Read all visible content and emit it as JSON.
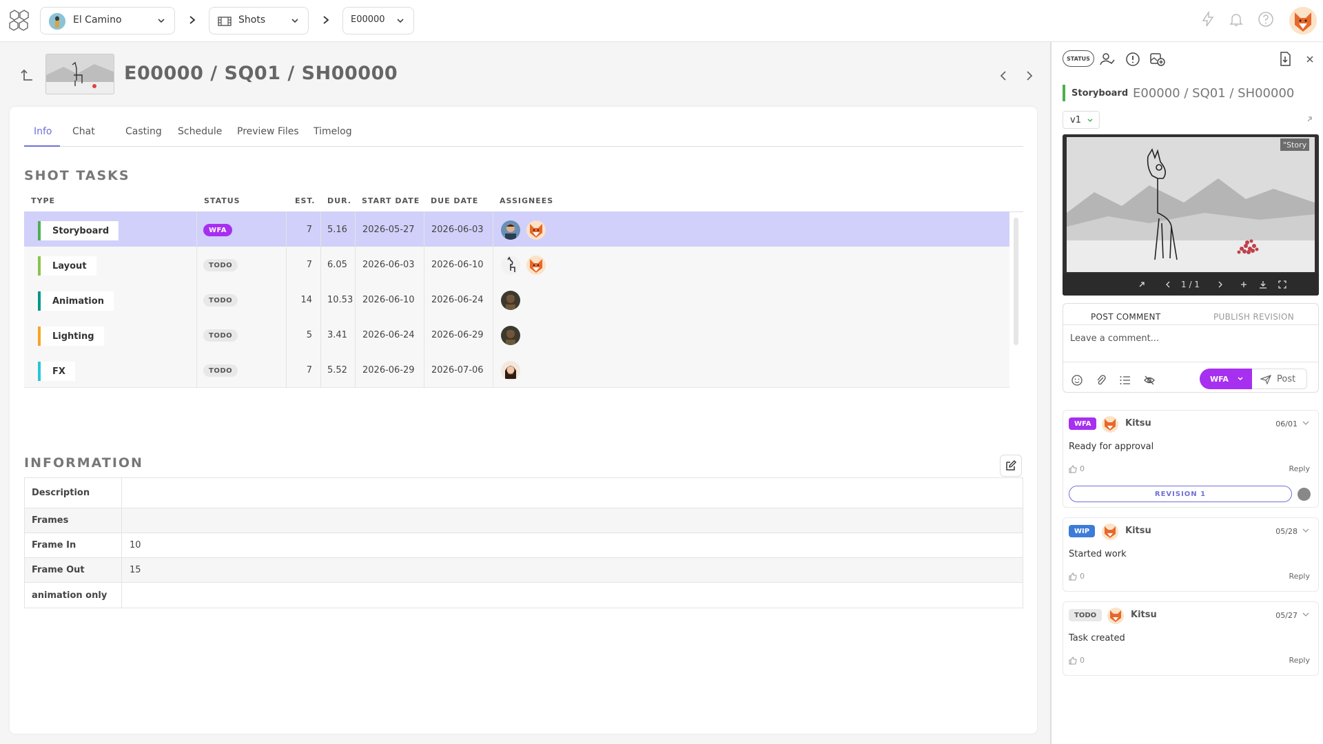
{
  "topbar": {
    "production": "El Camino",
    "entity_type": "Shots",
    "episode": "E00000"
  },
  "header": {
    "title": "E00000 / SQ01 / SH00000"
  },
  "tabs": [
    "Info",
    "Chat",
    "Casting",
    "Schedule",
    "Preview Files",
    "Timelog"
  ],
  "shot_tasks": {
    "title": "SHOT TASKS",
    "columns": [
      "TYPE",
      "STATUS",
      "EST.",
      "DUR.",
      "START DATE",
      "DUE DATE",
      "ASSIGNEES"
    ],
    "rows": [
      {
        "type": "Storyboard",
        "type_color": "#4caf50",
        "status": "WFA",
        "est": "7",
        "dur": "5.16",
        "start": "2026-05-27",
        "due": "2026-06-03",
        "assignees": [
          "man-avatar",
          "fox-avatar"
        ]
      },
      {
        "type": "Layout",
        "type_color": "#8bc34a",
        "status": "TODO",
        "est": "7",
        "dur": "6.05",
        "start": "2026-06-03",
        "due": "2026-06-10",
        "assignees": [
          "llama-avatar",
          "fox-avatar"
        ]
      },
      {
        "type": "Animation",
        "type_color": "#009688",
        "status": "TODO",
        "est": "14",
        "dur": "10.53",
        "start": "2026-06-10",
        "due": "2026-06-24",
        "assignees": [
          "woman-avatar"
        ]
      },
      {
        "type": "Lighting",
        "type_color": "#f5a623",
        "status": "TODO",
        "est": "5",
        "dur": "3.41",
        "start": "2026-06-24",
        "due": "2026-06-29",
        "assignees": [
          "woman-avatar"
        ]
      },
      {
        "type": "FX",
        "type_color": "#26c6da",
        "status": "TODO",
        "est": "7",
        "dur": "5.52",
        "start": "2026-06-29",
        "due": "2026-07-06",
        "assignees": [
          "girl-avatar"
        ]
      }
    ]
  },
  "information": {
    "title": "INFORMATION",
    "rows": [
      {
        "label": "Description",
        "value": ""
      },
      {
        "label": "Frames",
        "value": ""
      },
      {
        "label": "Frame In",
        "value": "10"
      },
      {
        "label": "Frame Out",
        "value": "15"
      },
      {
        "label": "animation only",
        "value": ""
      }
    ]
  },
  "panel": {
    "status_button": "STATUS",
    "task_type": "Storyboard",
    "title": "E00000 / SQ01 / SH00000",
    "version": "v1",
    "preview_label": "\"Story",
    "frame_counter": "1 / 1",
    "comment_tabs": [
      "POST COMMENT",
      "PUBLISH REVISION"
    ],
    "comment_placeholder": "Leave a comment...",
    "post_status": "WFA",
    "post_label": "Post",
    "comments": [
      {
        "status": "WFA",
        "status_color": "#a72ff0",
        "author": "Kitsu",
        "date": "06/01",
        "text": "Ready for approval",
        "likes": "0",
        "reply": "Reply",
        "revision": "REVISION 1"
      },
      {
        "status": "WIP",
        "status_color": "#3d7bd9",
        "author": "Kitsu",
        "date": "05/28",
        "text": "Started work",
        "likes": "0",
        "reply": "Reply"
      },
      {
        "status": "TODO",
        "status_color": "#e8e8e8",
        "author": "Kitsu",
        "date": "05/27",
        "text": "Task created",
        "likes": "0",
        "reply": "Reply"
      }
    ]
  },
  "colors": {
    "accent": "#6f70d9",
    "wfa": "#a72ff0",
    "wip": "#3d7bd9",
    "selected_row": "#d0d0fa"
  }
}
